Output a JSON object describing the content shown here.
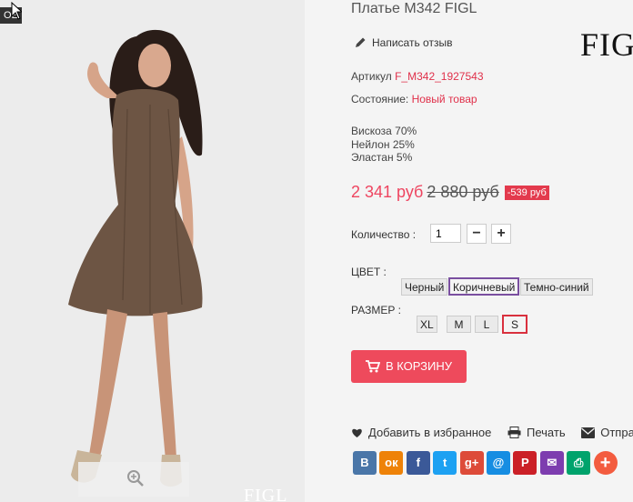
{
  "photo": {
    "badge": "OE",
    "watermark": "FIGL"
  },
  "product": {
    "title": "Платье M342 FIGL",
    "review_link": "Написать отзыв",
    "brand_logo": "FIGL",
    "sku_label": "Артикул",
    "sku_value": "F_M342_1927543",
    "condition_label": "Состояние:",
    "condition_value": "Новый товар",
    "composition": [
      "Вискоза 70%",
      "Нейлон 25%",
      "Эластан 5%"
    ],
    "price_new": "2 341 руб",
    "price_old": "2 880 руб",
    "discount": "-539 руб",
    "quantity_label": "Количество :",
    "quantity_value": "1",
    "minus": "−",
    "plus": "+",
    "color_label": "ЦВЕТ :",
    "colors": [
      "Черный",
      "Коричневый",
      "Темно-синий"
    ],
    "selected_color": "Коричневый",
    "size_label": "РАЗМЕР :",
    "sizes": [
      "XL",
      "M",
      "L",
      "S"
    ],
    "selected_size": "S",
    "cart_button": "В КОРЗИНУ"
  },
  "actions": {
    "wishlist": "Добавить в избранное",
    "print": "Печать",
    "send": "Отправит"
  },
  "share": [
    {
      "icon": "vk-icon",
      "glyph": "В",
      "color": "#4a76a8"
    },
    {
      "icon": "odnoklassniki-icon",
      "glyph": "ок",
      "color": "#ee8208"
    },
    {
      "icon": "facebook-icon",
      "glyph": "f",
      "color": "#3b5998"
    },
    {
      "icon": "twitter-icon",
      "glyph": "t",
      "color": "#1da1f2"
    },
    {
      "icon": "google-plus-icon",
      "glyph": "g+",
      "color": "#dd4b39"
    },
    {
      "icon": "mail-at-icon",
      "glyph": "@",
      "color": "#168de2"
    },
    {
      "icon": "pinterest-icon",
      "glyph": "P",
      "color": "#cb2027"
    },
    {
      "icon": "email-icon",
      "glyph": "✉",
      "color": "#7d3daf"
    },
    {
      "icon": "print-icon",
      "glyph": "⎙",
      "color": "#00a36c"
    },
    {
      "icon": "more-plus-icon",
      "glyph": "+",
      "color": "#f35c3f"
    }
  ]
}
